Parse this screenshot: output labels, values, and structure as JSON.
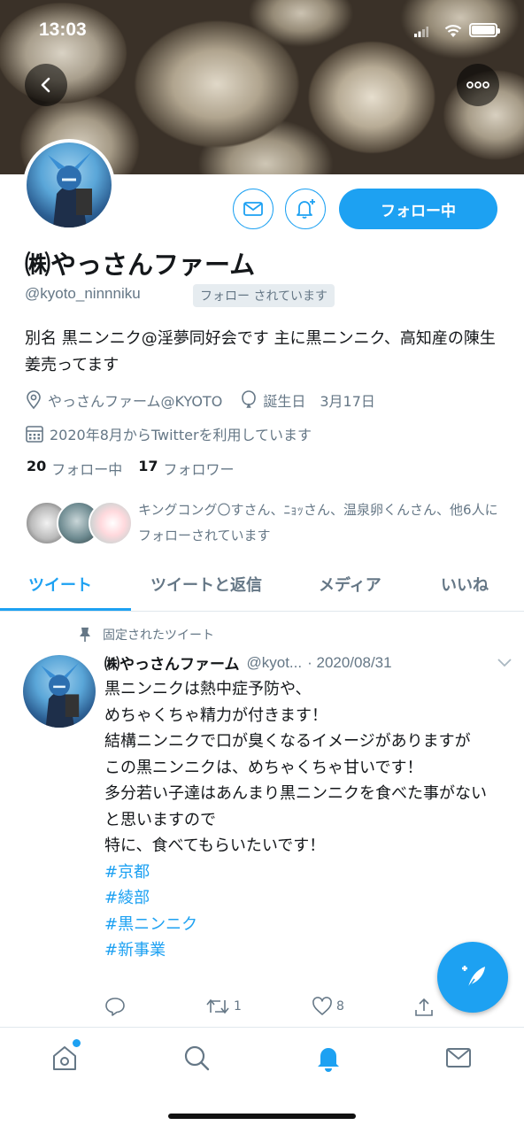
{
  "status_bar": {
    "time": "13:03"
  },
  "profile": {
    "name": "㈱やっさんファーム",
    "handle": "@kyoto_ninnniku",
    "follows_you_badge": "フォロー されています",
    "follow_button": "フォロー中",
    "bio": "別名 黒ニンニク@淫夢同好会です 主に黒ニンニク、高知産の陳生姜売ってます",
    "location": "やっさんファーム@KYOTO",
    "birthday_label": "誕生日",
    "birthday": "3月17日",
    "joined": "2020年8月からTwitterを利用しています",
    "following_count": "20",
    "following_label": "フォロー中",
    "followers_count": "17",
    "followers_label": "フォロワー",
    "followers_you_know": "キングコング〇すさん、ﾆｮｯさん、温泉卵くんさん、他6人にフォローされています"
  },
  "tabs": [
    {
      "label": "ツイート",
      "active": true
    },
    {
      "label": "ツイートと返信",
      "active": false
    },
    {
      "label": "メディア",
      "active": false
    },
    {
      "label": "いいね",
      "active": false
    }
  ],
  "tweet": {
    "pinned_label": "固定されたツイート",
    "name": "㈱やっさんファーム",
    "handle": "@kyot...",
    "date": "· 2020/08/31",
    "lines": [
      "黒ニンニクは熱中症予防や、",
      "めちゃくちゃ精力が付きます！",
      "結構ニンニクで口が臭くなるイメージがありますが",
      "この黒ニンニクは、めちゃくちゃ甘いです！",
      "多分若い子達はあんまり黒ニンニクを食べた事がないと思いますので",
      "特に、食べてもらいたいです！"
    ],
    "hashtags": [
      "#京都",
      "#綾部",
      "#黒ニンニク",
      "#新事業"
    ],
    "retweets": "1",
    "likes": "8"
  },
  "colors": {
    "accent": "#1da1f2",
    "muted": "#657786",
    "text": "#14171a"
  },
  "icons": {
    "back": "chevron-left-icon",
    "more": "ellipsis-icon",
    "mail": "envelope-icon",
    "notify": "bell-plus-icon",
    "location": "map-pin-icon",
    "birthday": "balloon-icon",
    "calendar": "calendar-icon",
    "pin": "pin-icon",
    "reply": "reply-icon",
    "retweet": "retweet-icon",
    "like": "heart-icon",
    "share": "share-icon",
    "compose": "compose-feather-icon",
    "home": "home-icon",
    "search": "search-icon",
    "notifications": "bell-icon",
    "messages": "envelope-icon"
  }
}
